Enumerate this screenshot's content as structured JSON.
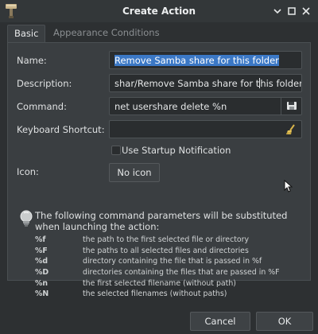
{
  "window": {
    "title": "Create Action",
    "controls": [
      "chevron-down-icon",
      "maximize-icon",
      "close-icon"
    ]
  },
  "tabs": [
    {
      "label": "Basic",
      "active": true
    },
    {
      "label": "Appearance Conditions",
      "active": false
    }
  ],
  "form": {
    "name_label": "Name:",
    "name_value": "Remove Samba share for this folder",
    "description_label": "Description:",
    "description_before_caret": "shar/Remove Samba share for t",
    "description_after_caret": "his folder",
    "command_label": "Command:",
    "command_value": "net usershare delete %n",
    "shortcut_label": "Keyboard Shortcut:",
    "shortcut_value": "",
    "startup_label": "Use Startup Notification",
    "startup_checked": false,
    "icon_label": "Icon:",
    "icon_button": "No icon"
  },
  "info": {
    "intro": "The following command parameters will be substituted when launching the action:",
    "params": [
      {
        "code": "%f",
        "desc": "the path to the first selected file or directory"
      },
      {
        "code": "%F",
        "desc": "the paths to all selected files and directories"
      },
      {
        "code": "%d",
        "desc": "directory containing the file that is passed in %f"
      },
      {
        "code": "%D",
        "desc": "directories containing the files that are passed in %F"
      },
      {
        "code": "%n",
        "desc": "the first selected filename (without path)"
      },
      {
        "code": "%N",
        "desc": "the selected filenames (without paths)"
      }
    ]
  },
  "footer": {
    "cancel_label": "Cancel",
    "ok_label": "OK"
  },
  "colors": {
    "window_bg": "#2d3032",
    "panel_bg": "#3a3e41",
    "selection": "#3b78c6",
    "text": "#dfe1e2"
  }
}
